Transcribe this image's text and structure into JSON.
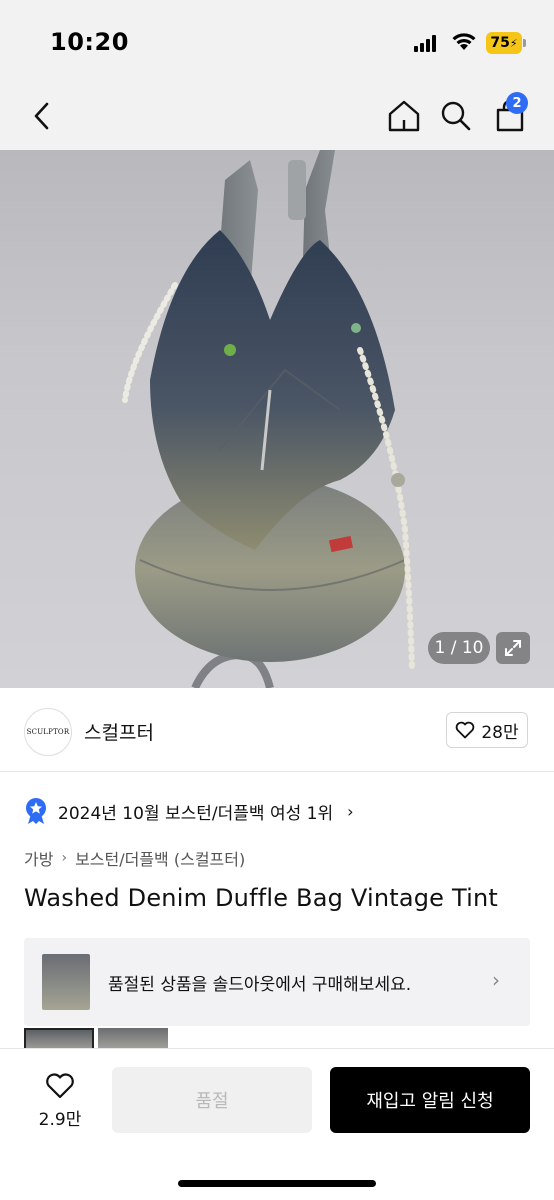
{
  "status": {
    "time": "10:20",
    "battery": "75"
  },
  "nav": {
    "cart_count": "2"
  },
  "hero": {
    "counter": "1 / 10"
  },
  "brand": {
    "logo_text": "SCULPTOR",
    "name": "스컬프터",
    "likes": "28만"
  },
  "ranking": {
    "text": "2024년 10월 보스턴/더플백 여성 1위",
    "arrow": "›"
  },
  "breadcrumb": {
    "items": [
      "가방",
      "보스턴/더플백 (스컬프터)"
    ],
    "separator": "›"
  },
  "product": {
    "title": "Washed Denim Duffle Bag Vintage Tint"
  },
  "soldout_banner": {
    "text": "품절된 상품을 솔드아웃에서 구매해보세요.",
    "arrow": "›"
  },
  "bottom": {
    "wish_count": "2.9만",
    "soldout_label": "품절",
    "restock_label": "재입고 알림 신청"
  },
  "colors": {
    "accent": "#2f6cf5",
    "battery": "#f5c518",
    "primary_button": "#000000"
  }
}
